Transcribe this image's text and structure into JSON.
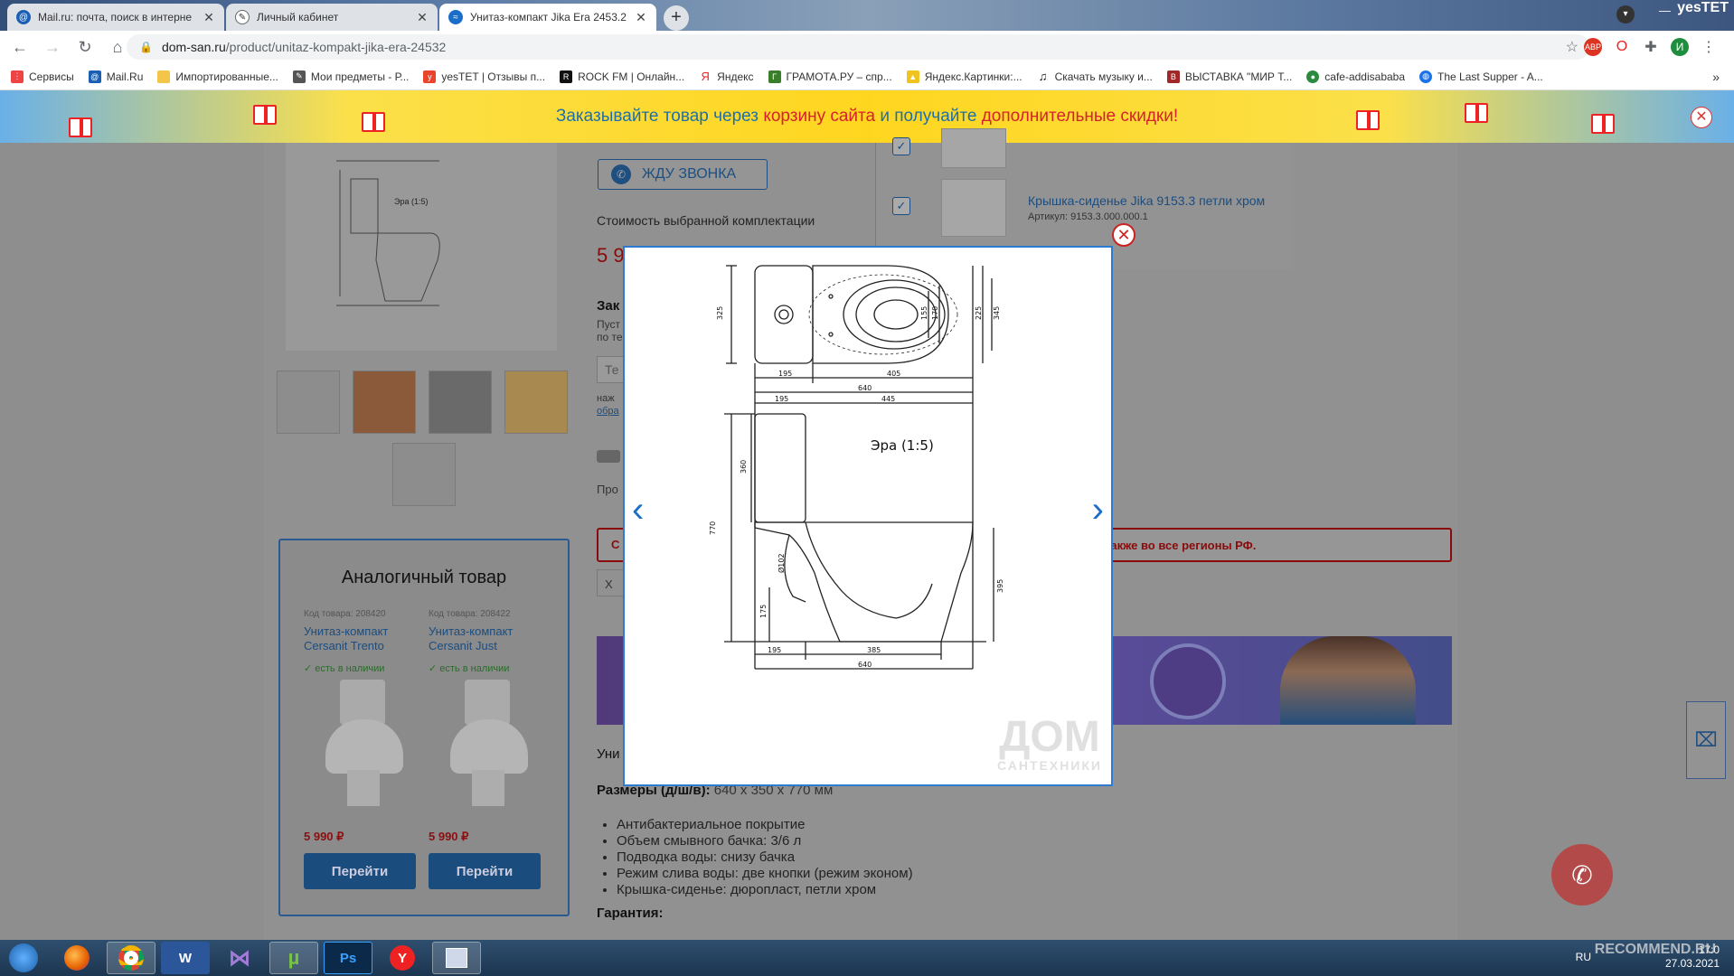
{
  "browser": {
    "tabs": [
      {
        "title": "Mail.ru: почта, поиск в интерне",
        "favicon": "mailru-icon",
        "active": false
      },
      {
        "title": "Личный кабинет",
        "favicon": "pen-icon",
        "active": false
      },
      {
        "title": "Унитаз-компакт Jika Era 2453.2 ...",
        "favicon": "site-icon",
        "active": true
      }
    ],
    "address": {
      "host": "dom-san.ru",
      "path": "/product/unitaz-kompakt-jika-era-24532"
    },
    "window_label": "yesTET",
    "bookmarks": [
      {
        "label": "Сервисы",
        "icon": "apps-icon",
        "color": "#e44"
      },
      {
        "label": "Mail.Ru",
        "icon": "mailru-icon",
        "color": "#1a5fb4"
      },
      {
        "label": "Импортированные...",
        "icon": "folder-icon",
        "color": "#f3c64a"
      },
      {
        "label": "Мои предметы - Р...",
        "icon": "pen-icon",
        "color": "#555"
      },
      {
        "label": "yesTET | Отзывы п...",
        "icon": "yestet-icon",
        "color": "#e8452c"
      },
      {
        "label": "ROCK FM | Онлайн...",
        "icon": "rockfm-icon",
        "color": "#111"
      },
      {
        "label": "Яндекс",
        "icon": "yandex-icon",
        "color": "#e22"
      },
      {
        "label": "ГРАМОТА.РУ – спр...",
        "icon": "gramota-icon",
        "color": "#3a7d2a"
      },
      {
        "label": "Яндекс.Картинки:...",
        "icon": "image-icon",
        "color": "#f0c420"
      },
      {
        "label": "Скачать музыку и...",
        "icon": "music-icon",
        "color": "#111"
      },
      {
        "label": "ВЫСТАВКА \"МИР Т...",
        "icon": "expo-icon",
        "color": "#a02828"
      },
      {
        "label": "cafe-addisababa",
        "icon": "cafe-icon",
        "color": "#2b8a3e"
      },
      {
        "label": "The Last Supper - A...",
        "icon": "globe-icon",
        "color": "#1a73e8"
      }
    ]
  },
  "promo": {
    "part1": "Заказывайте товар через ",
    "part2": "корзину сайта",
    "part3": " и получайте ",
    "part4": "дополнительные скидки!"
  },
  "product": {
    "call_button": "ЖДУ ЗВОНКА",
    "cost_label": "Стоимость выбранной комплектации",
    "price_partial": "5 9",
    "order_label": "Зак",
    "order_lines": [
      "Пуст",
      "по те"
    ],
    "phone_placeholder": "Те",
    "consent_lines": [
      "наж",
      "обра"
    ],
    "pro_label": "Про",
    "notice_text": "также во все регионы РФ.",
    "x_label": "Х",
    "title_partial": "Уни",
    "size_label": "Размеры (д/ш/в):",
    "size_value": " 640 х 350 х 770 мм",
    "features": [
      "Антибактериальное покрытие",
      "Объем смывного бачка: 3/6 л",
      "Подводка воды: снизу бачка",
      "Режим слива воды: две кнопки (режим эконом)",
      "Крышка-сиденье: дюропласт, петли хром"
    ],
    "warranty_label": "Гарантия:",
    "side_item": {
      "name": "Крышка-сиденье Jika 9153.3 петли хром",
      "article": "Артикул: 9153.3.000.000.1",
      "checked": true
    }
  },
  "analog": {
    "heading": "Аналогичный товар",
    "items": [
      {
        "code": "Код товара: 208420",
        "name": "Унитаз-компакт Cersanit Trento",
        "stock": "есть в наличии",
        "price": "5 990 ₽",
        "button": "Перейти"
      },
      {
        "code": "Код товара: 208422",
        "name": "Унитаз-компакт Cersanit Just",
        "stock": "есть в наличии",
        "price": "5 990 ₽",
        "button": "Перейти"
      }
    ]
  },
  "drawing": {
    "caption": "Эра (1:5)",
    "dims_top": {
      "left_w": "195",
      "right_w": "405",
      "total": "640",
      "depth": "325",
      "inner_a": "225",
      "inner_b": "345",
      "seat_a": "155",
      "seat_b": "170"
    },
    "dims_side": {
      "top_left": "195",
      "top_right": "445",
      "height": "770",
      "tank_h": "360",
      "bowl_h": "395",
      "outlet_h": "175",
      "pipe": "Ø102",
      "base_left": "195",
      "base_mid": "385",
      "total": "640"
    },
    "watermark_big": "ДОМ",
    "watermark_small": "САНТЕХНИКИ"
  },
  "taskbar": {
    "apps": [
      "start",
      "firefox",
      "chrome",
      "word",
      "vs",
      "torrent",
      "photoshop",
      "yandex",
      "editor"
    ],
    "lang": "RU",
    "time": "17:0",
    "date": "27.03.2021",
    "recommend": "RECOMMEND.RU"
  },
  "colors": {
    "promo_link": "#d6202e",
    "brand_blue": "#1a4c7e",
    "price_red": "#8a0b0b",
    "modal_border": "#2c7bd1"
  }
}
